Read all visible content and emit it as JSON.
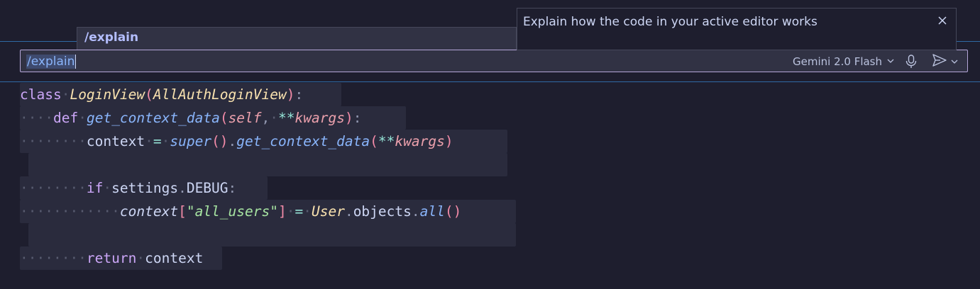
{
  "chat": {
    "input_value": "/explain",
    "model_label": "Gemini 2.0 Flash"
  },
  "suggestion": {
    "command": "/explain",
    "description": "Explain how the code in your active editor works"
  },
  "icons": {
    "mic": "microphone-icon",
    "send": "send-icon",
    "chevron": "chevron-down-icon",
    "close": "close-icon"
  },
  "colors": {
    "background": "#1e1e2e",
    "input_border": "#b4a6d8",
    "accent": "#89b4fa",
    "divider": "#2f6aa5"
  },
  "code": {
    "l1": {
      "kw": "class",
      "cls": "LoginView",
      "p1": "(",
      "base": "AllAuthLoginView",
      "p2": ")",
      "colon": ":"
    },
    "l2": {
      "ws": "···",
      "kw": "def",
      "fn": "get_context_data",
      "p1": "(",
      "self": "self",
      "comma": ",",
      "ws2": "·",
      "op": "**",
      "kwargs": "kwargs",
      "p2": ")",
      "colon": ":"
    },
    "l3": {
      "ws": "········",
      "var": "context",
      "eq": "=",
      "sup": "super",
      "p1": "()",
      "dot": ".",
      "fn": "get_context_data",
      "p2": "(",
      "op": "**",
      "kwargs": "kwargs",
      "p3": ")"
    },
    "l5": {
      "ws": "········",
      "kw": "if",
      "obj": "settings",
      "dot": ".",
      "attr": "DEBUG",
      "colon": ":"
    },
    "l6": {
      "ws": "············",
      "var": "context",
      "b1": "[",
      "str": "\"all_users\"",
      "b2": "]",
      "eq": "=",
      "cls": "User",
      "dot1": ".",
      "attr": "objects",
      "dot2": ".",
      "fn": "all",
      "p": "()"
    },
    "l8": {
      "ws": "········",
      "kw": "return",
      "var": "context"
    }
  }
}
